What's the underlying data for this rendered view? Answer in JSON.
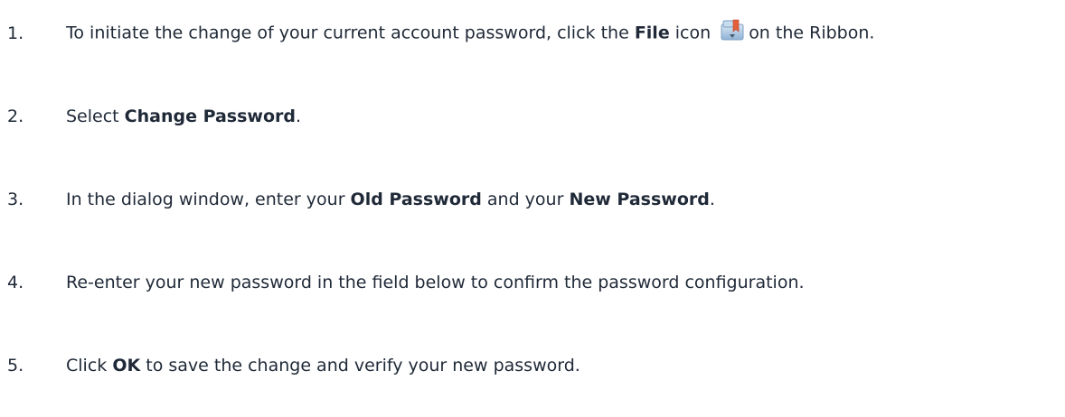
{
  "steps": [
    {
      "number": "1.",
      "parts": [
        {
          "text": "To initiate the change of your current account password, click the ",
          "bold": false
        },
        {
          "text": "File",
          "bold": true
        },
        {
          "text": " icon",
          "bold": false
        },
        {
          "icon": "file-icon"
        },
        {
          "text": "on the Ribbon.",
          "bold": false
        }
      ]
    },
    {
      "number": "2.",
      "parts": [
        {
          "text": "Select ",
          "bold": false
        },
        {
          "text": "Change Password",
          "bold": true
        },
        {
          "text": ".",
          "bold": false
        }
      ]
    },
    {
      "number": "3.",
      "parts": [
        {
          "text": "In the dialog window, enter your ",
          "bold": false
        },
        {
          "text": "Old Password",
          "bold": true
        },
        {
          "text": " and your ",
          "bold": false
        },
        {
          "text": "New Password",
          "bold": true
        },
        {
          "text": ".",
          "bold": false
        }
      ]
    },
    {
      "number": "4.",
      "parts": [
        {
          "text": "Re-enter your new password in the field below to confirm the password configuration.",
          "bold": false
        }
      ]
    },
    {
      "number": "5.",
      "parts": [
        {
          "text": "Click ",
          "bold": false
        },
        {
          "text": "OK",
          "bold": true
        },
        {
          "text": " to save the change and verify your new password.",
          "bold": false
        }
      ]
    }
  ],
  "colors": {
    "text": "#1f2937",
    "icon_folder": "#a9c6e2",
    "icon_bookmark": "#e2603a"
  }
}
